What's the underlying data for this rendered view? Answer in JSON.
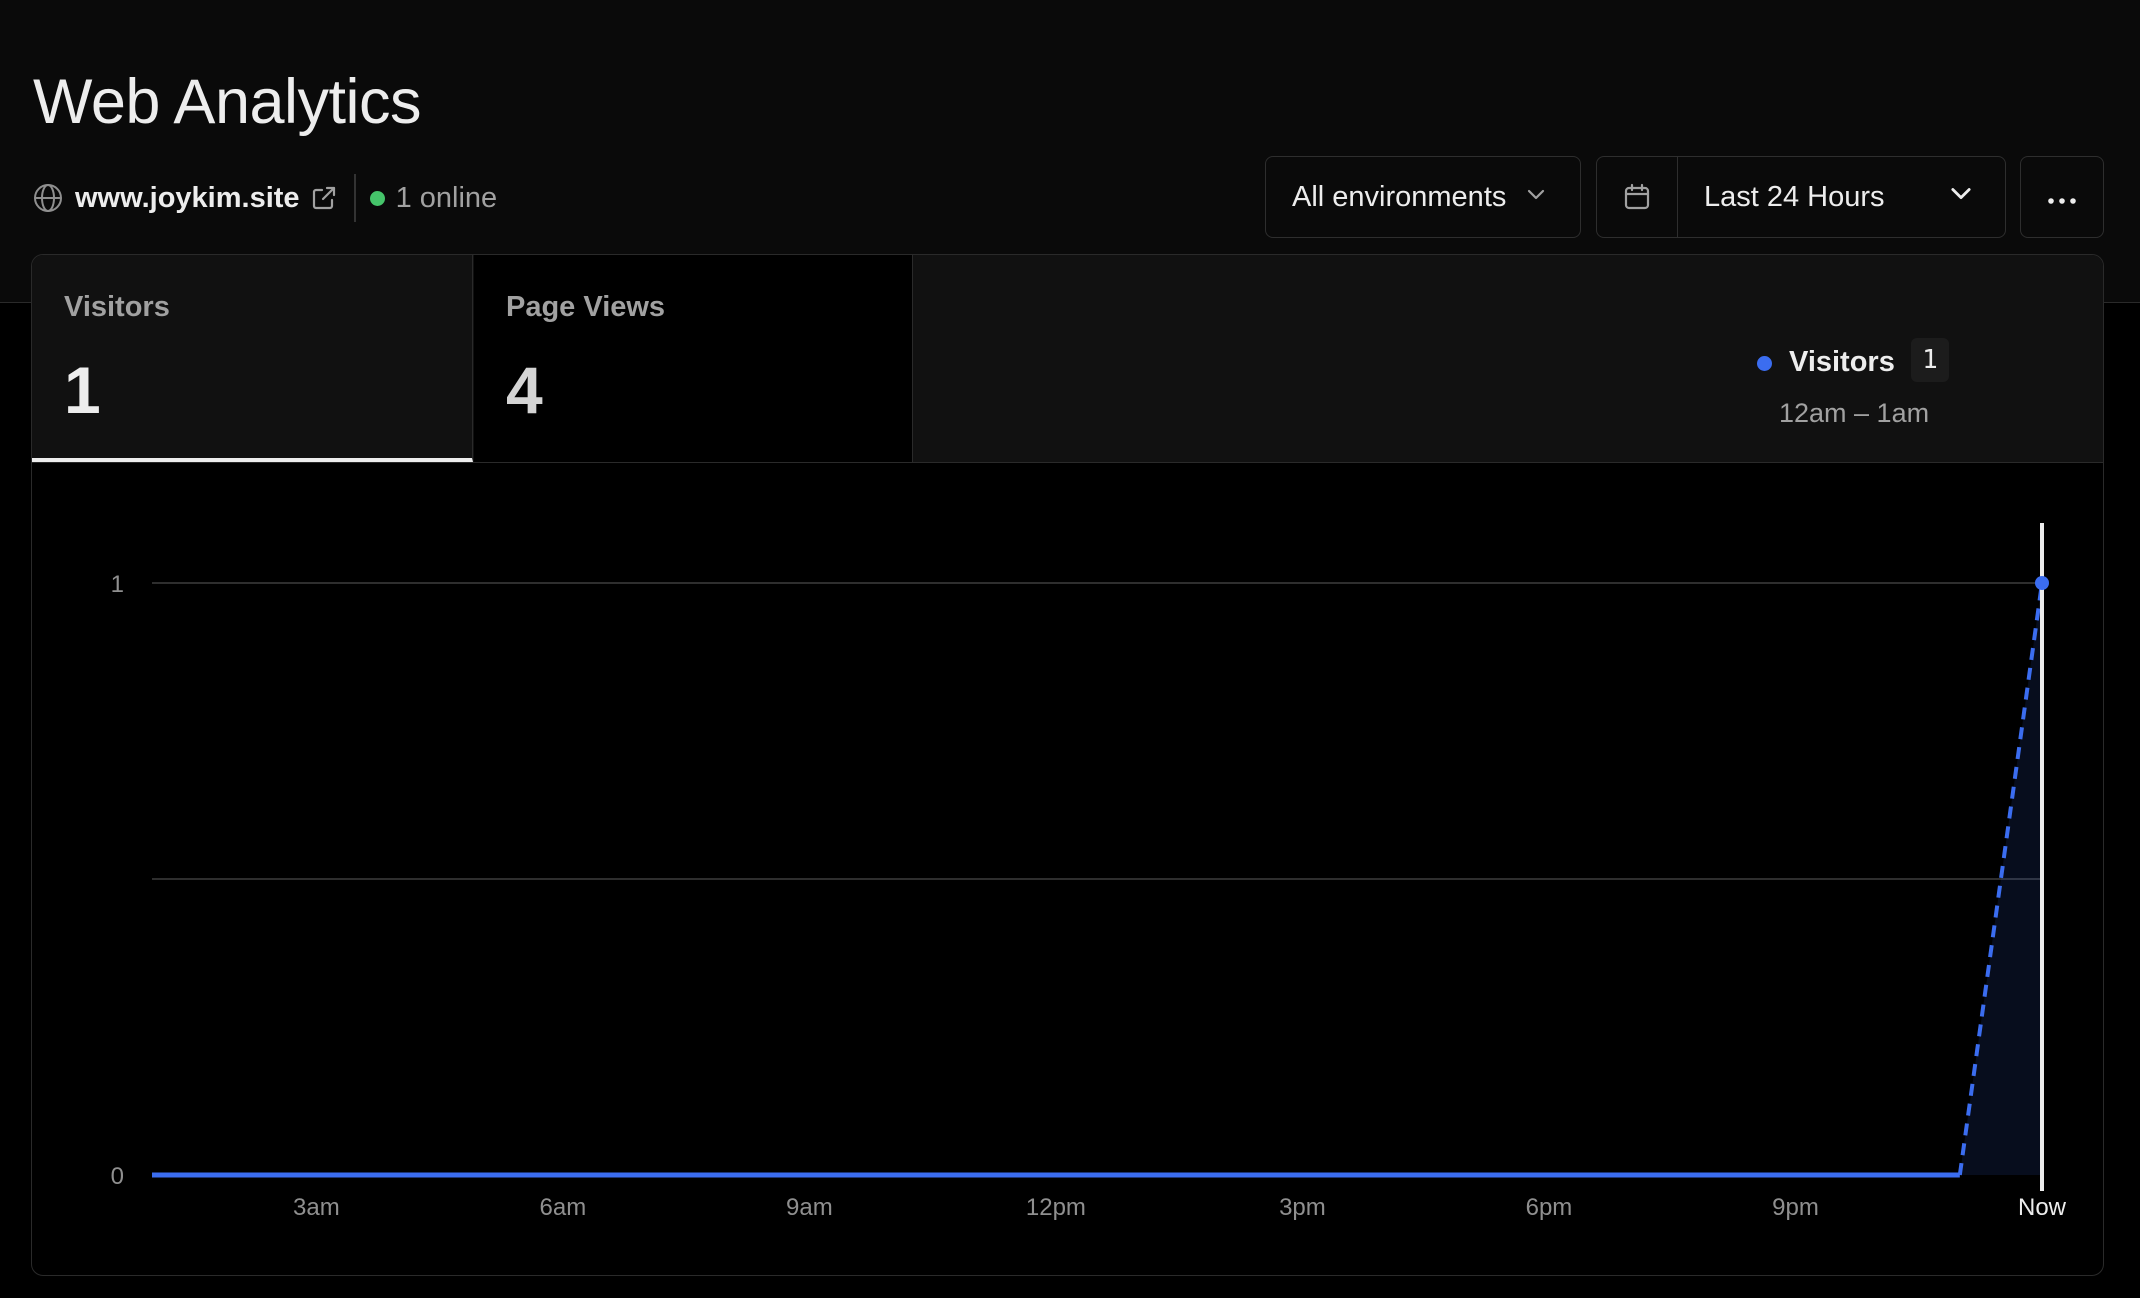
{
  "header": {
    "title": "Web Analytics",
    "site": "www.joykim.site",
    "online": "1 online",
    "environment": "All environments",
    "range": "Last 24 Hours"
  },
  "tabs": [
    {
      "label": "Visitors",
      "value": "1",
      "active": true
    },
    {
      "label": "Page Views",
      "value": "4",
      "active": false
    }
  ],
  "tooltip": {
    "series": "Visitors",
    "value": "1",
    "range": "12am – 1am"
  },
  "colors": {
    "accent": "#3b6df0",
    "online": "#45c46a",
    "background": "#000000"
  },
  "icons": [
    "globe-icon",
    "external-link-icon",
    "chevron-down-icon",
    "calendar-icon",
    "more-icon"
  ],
  "chart_data": {
    "type": "area",
    "x_ticks": [
      "3am",
      "6am",
      "9am",
      "12pm",
      "3pm",
      "6pm",
      "9pm",
      "Now"
    ],
    "y_ticks": [
      "0",
      "1"
    ],
    "ylim": [
      0,
      1
    ],
    "series": [
      {
        "name": "Visitors",
        "x_hours_ago": [
          23,
          22,
          21,
          20,
          19,
          18,
          17,
          16,
          15,
          14,
          13,
          12,
          11,
          10,
          9,
          8,
          7,
          6,
          5,
          4,
          3,
          2,
          1,
          0
        ],
        "values": [
          0,
          0,
          0,
          0,
          0,
          0,
          0,
          0,
          0,
          0,
          0,
          0,
          0,
          0,
          0,
          0,
          0,
          0,
          0,
          0,
          0,
          0,
          0,
          1
        ]
      }
    ],
    "grid": true,
    "legend": "none"
  }
}
